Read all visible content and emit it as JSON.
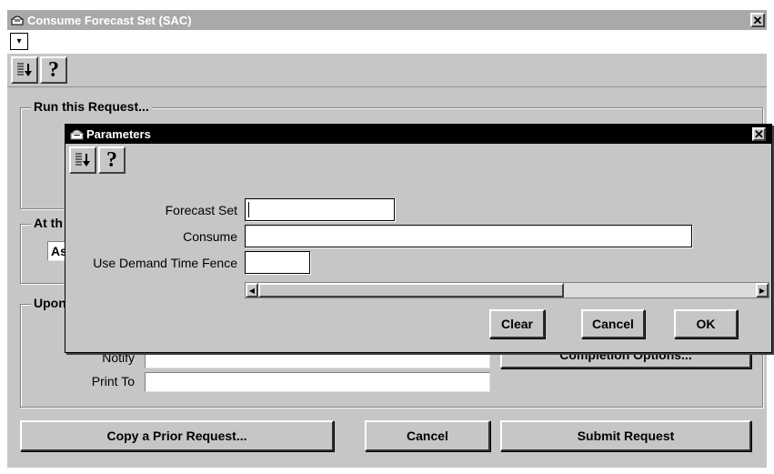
{
  "window": {
    "title": "Consume Forecast Set (SAC)",
    "close_label": "✕",
    "menu_label": "▾"
  },
  "toolbar": {
    "icons": [
      "list-navigator-icon",
      "help-icon"
    ],
    "help_glyph": "?"
  },
  "run_group": {
    "title": "Run this Request..."
  },
  "at_group": {
    "title_visible": "At th",
    "field_visible": "As"
  },
  "upon_group": {
    "title_visible": "Upon",
    "notify_label": "Notify",
    "notify_value": "",
    "print_to_label": "Print To",
    "print_to_value": "",
    "completion_button": "Completion Options..."
  },
  "footer": {
    "copy_button": "Copy a Prior Request...",
    "cancel_button": "Cancel",
    "submit_button": "Submit Request"
  },
  "dialog": {
    "title": "Parameters",
    "close_label": "✕",
    "help_glyph": "?",
    "fields": [
      {
        "label": "Forecast Set",
        "value": ""
      },
      {
        "label": "Consume",
        "value": ""
      },
      {
        "label": "Use Demand Time Fence",
        "value": ""
      }
    ],
    "scroll_left": "◀",
    "scroll_right": "▶",
    "buttons": {
      "clear": "Clear",
      "cancel": "Cancel",
      "ok": "OK"
    }
  }
}
